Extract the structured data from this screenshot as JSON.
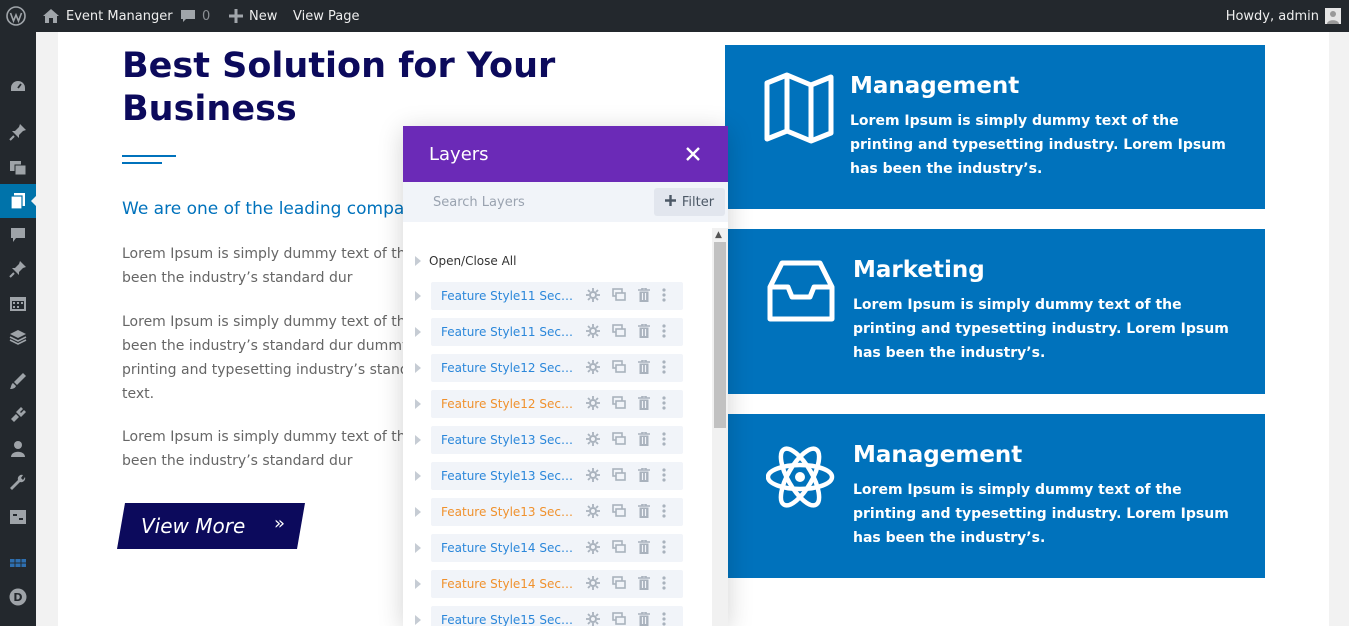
{
  "adminbar": {
    "site_name": "Event Mananger",
    "comments_count": "0",
    "new_label": "New",
    "view_page_label": "View Page",
    "howdy_label": "Howdy, admin"
  },
  "adminmenu": {
    "icons": [
      "dashboard-icon",
      "pin-icon",
      "media-icon",
      "pages-icon",
      "comments-icon",
      "pin-icon",
      "calendar-icon",
      "feedback-icon",
      "appearance-icon",
      "plugins-icon",
      "users-icon",
      "tools-icon",
      "settings-icon",
      "layers-icon",
      "divi-icon"
    ]
  },
  "hero": {
    "title": "Best Solution for Your Business",
    "subtitle": "We are one of the leading compa",
    "paragraphs": [
      "Lorem Ipsum is simply dummy text of the p Ipsum has been the industry’s standard dur",
      "Lorem Ipsum is simply dummy text of the p Ipsum has been the industry’s standard dur dummy text of the printing and typesetting industry’s standard dummy text.",
      "Lorem Ipsum is simply dummy text of the p Ipsum has been the industry’s standard dur"
    ],
    "button_label": "View More",
    "button_arrow": "»",
    "accent_color": "#0072bc",
    "title_color": "#0c0a5c"
  },
  "cards": [
    {
      "title": "Management",
      "desc": "Lorem Ipsum is simply dummy text of the printing and typesetting industry. Lorem Ipsum has been the industry’s.",
      "icon": "map-icon"
    },
    {
      "title": "Marketing",
      "desc": "Lorem Ipsum is simply dummy text of the printing and typesetting industry. Lorem Ipsum has been the industry’s.",
      "icon": "inbox-icon"
    },
    {
      "title": "Management",
      "desc": "Lorem Ipsum is simply dummy text of the printing and typesetting industry. Lorem Ipsum has been the industry’s.",
      "icon": "atom-icon"
    }
  ],
  "layers": {
    "title": "Layers",
    "search_placeholder": "Search Layers",
    "filter_label": "Filter",
    "open_close_all": "Open/Close All",
    "header_color": "#6b2ab7",
    "items": [
      {
        "label": "Feature Style11 Section",
        "color": "blue"
      },
      {
        "label": "Feature Style11 Secti...",
        "color": "blue"
      },
      {
        "label": "Feature Style12 Section",
        "color": "blue"
      },
      {
        "label": "Feature Style12 Secti...",
        "color": "orange"
      },
      {
        "label": "Feature Style13 Section",
        "color": "blue"
      },
      {
        "label": "Feature Style13 Secti...",
        "color": "blue"
      },
      {
        "label": "Feature Style13 Secti...",
        "color": "orange"
      },
      {
        "label": "Feature Style14 Section",
        "color": "blue"
      },
      {
        "label": "Feature Style14 Secti...",
        "color": "orange"
      },
      {
        "label": "Feature Style15 Section",
        "color": "blue"
      }
    ]
  }
}
